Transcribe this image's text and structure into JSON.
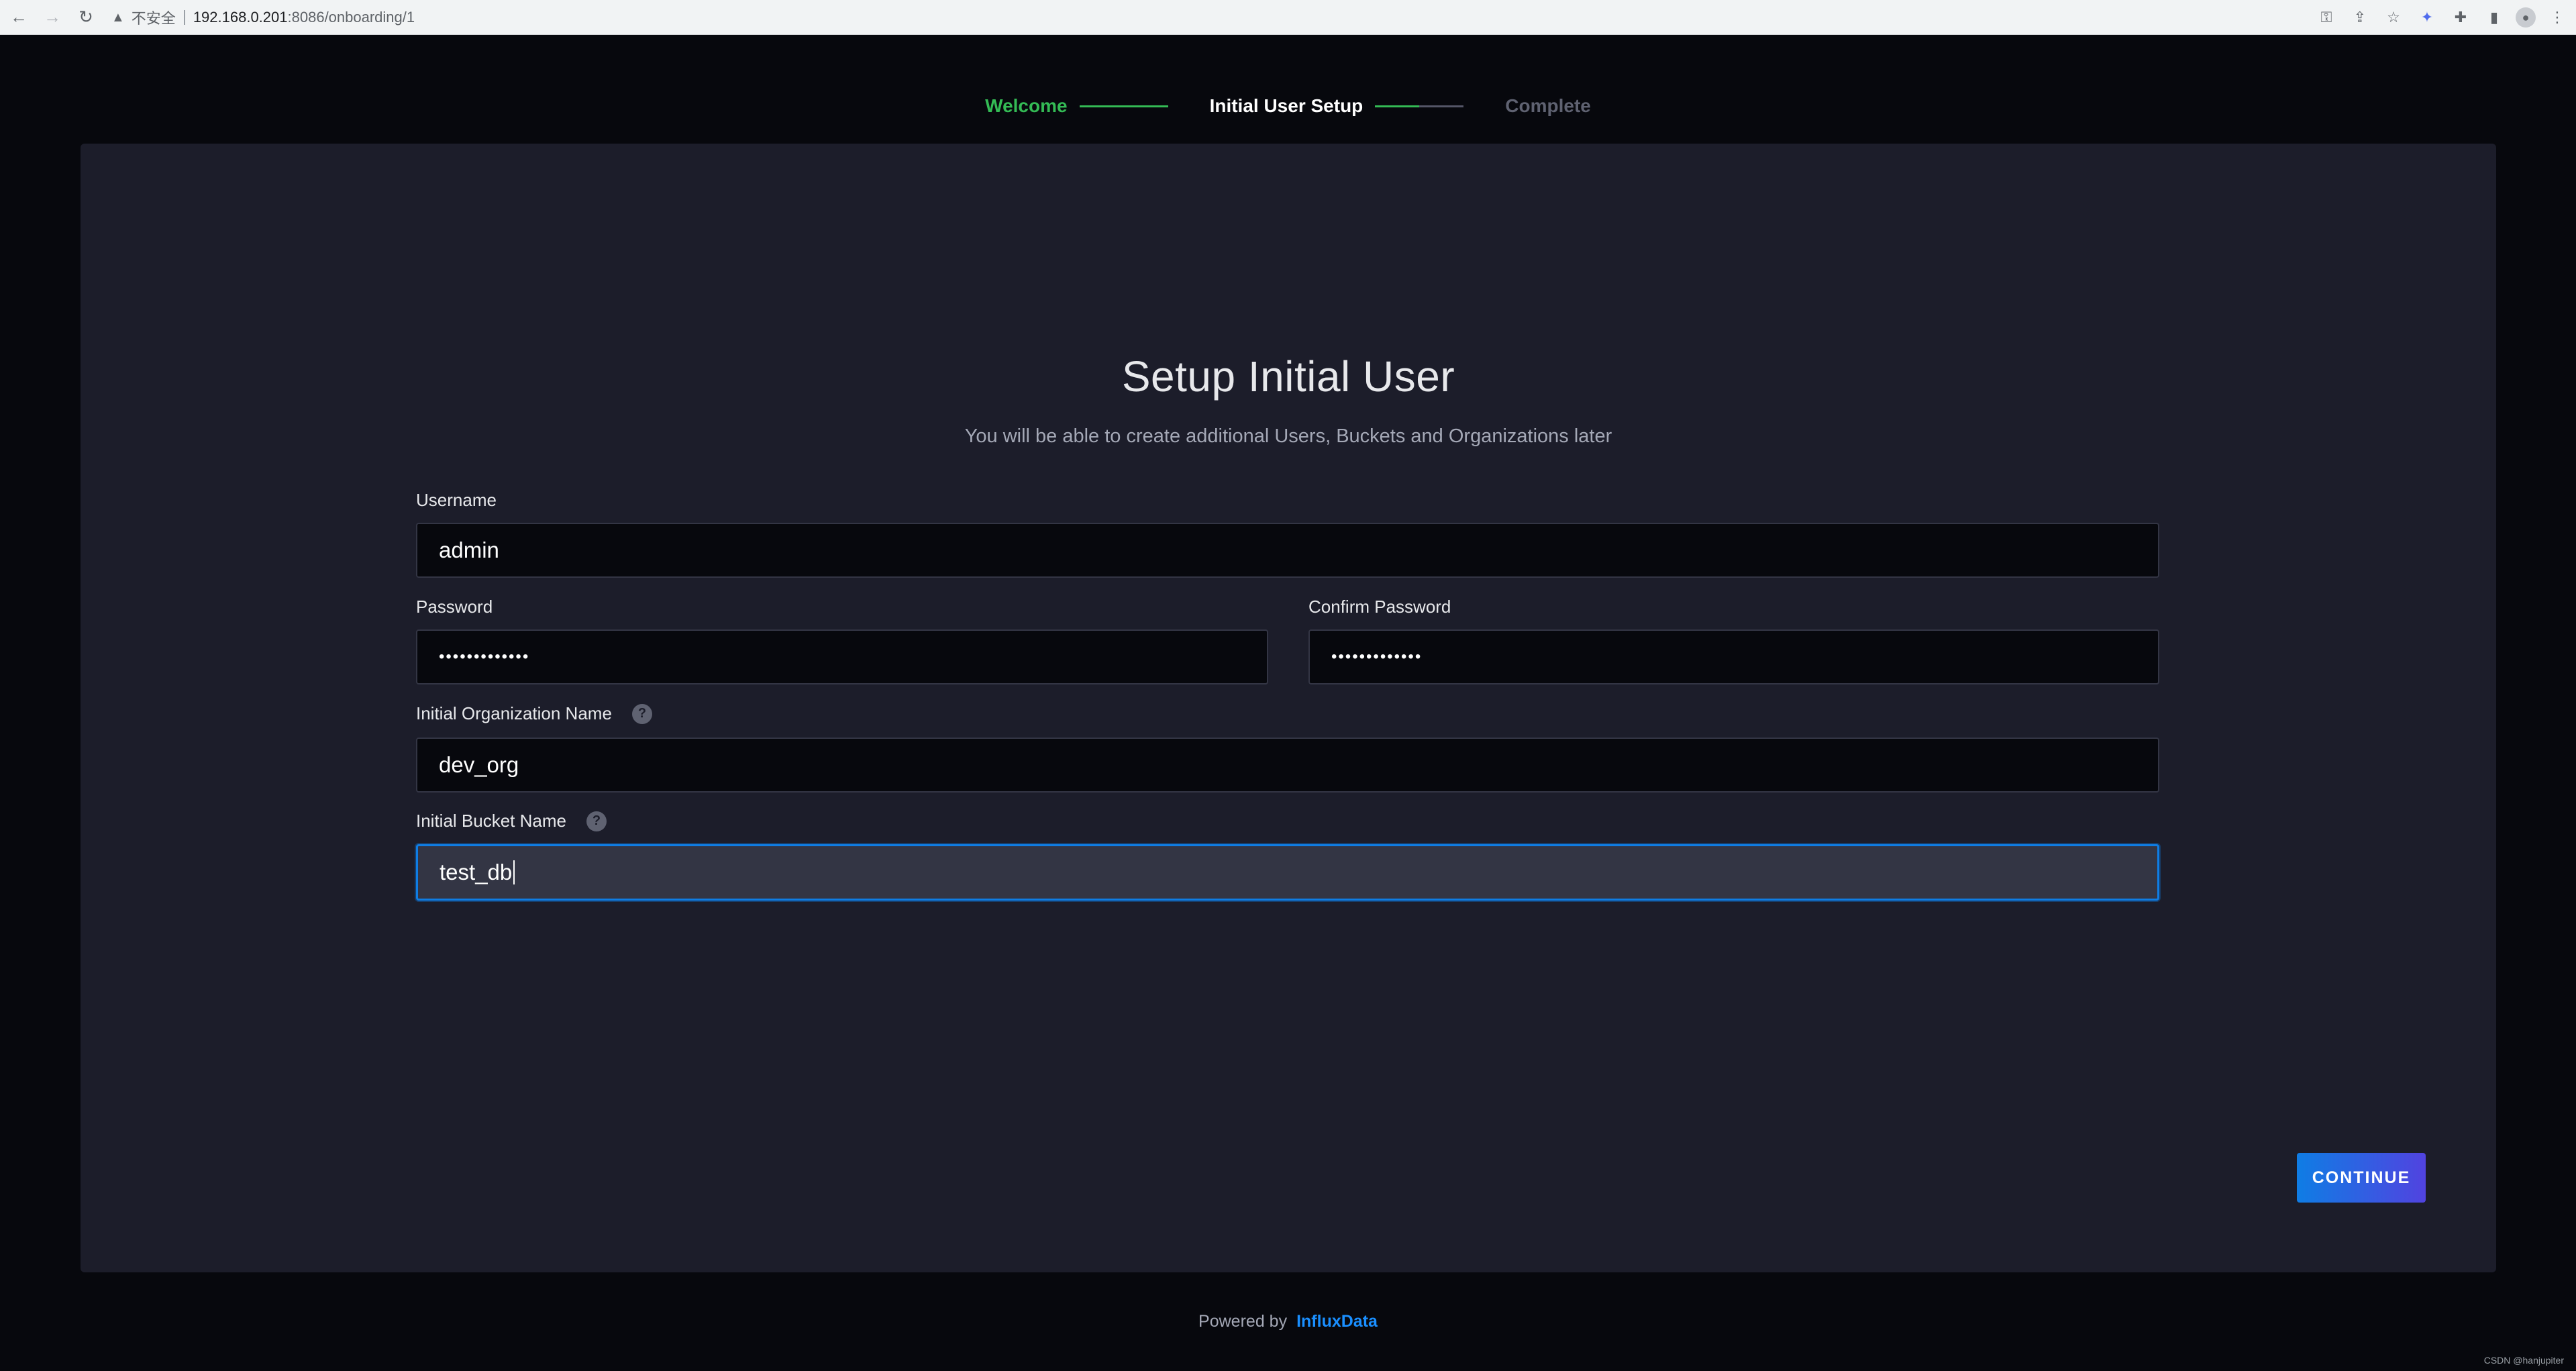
{
  "browser": {
    "security_label": "不安全",
    "url_host": "192.168.0.201",
    "url_path": ":8086/onboarding/1"
  },
  "stepper": {
    "steps": [
      "Welcome",
      "Initial User Setup",
      "Complete"
    ]
  },
  "page": {
    "title": "Setup Initial User",
    "subtitle": "You will be able to create additional Users, Buckets and Organizations later"
  },
  "form": {
    "username_label": "Username",
    "username_value": "admin",
    "password_label": "Password",
    "password_value": "•••••••••••••",
    "confirm_label": "Confirm Password",
    "confirm_value": "•••••••••••••",
    "org_label": "Initial Organization Name",
    "org_value": "dev_org",
    "bucket_label": "Initial Bucket Name",
    "bucket_value": "test_db"
  },
  "actions": {
    "continue_label": "CONTINUE"
  },
  "footer": {
    "powered_by": "Powered by",
    "brand": "InfluxData"
  },
  "watermark": "CSDN @hanjupiter",
  "colors": {
    "accent_blue": "#0f7de4",
    "accent_purple": "#5143e0",
    "step_done": "#34bb55",
    "card_bg": "#1c1d2a",
    "page_bg": "#07080d"
  }
}
